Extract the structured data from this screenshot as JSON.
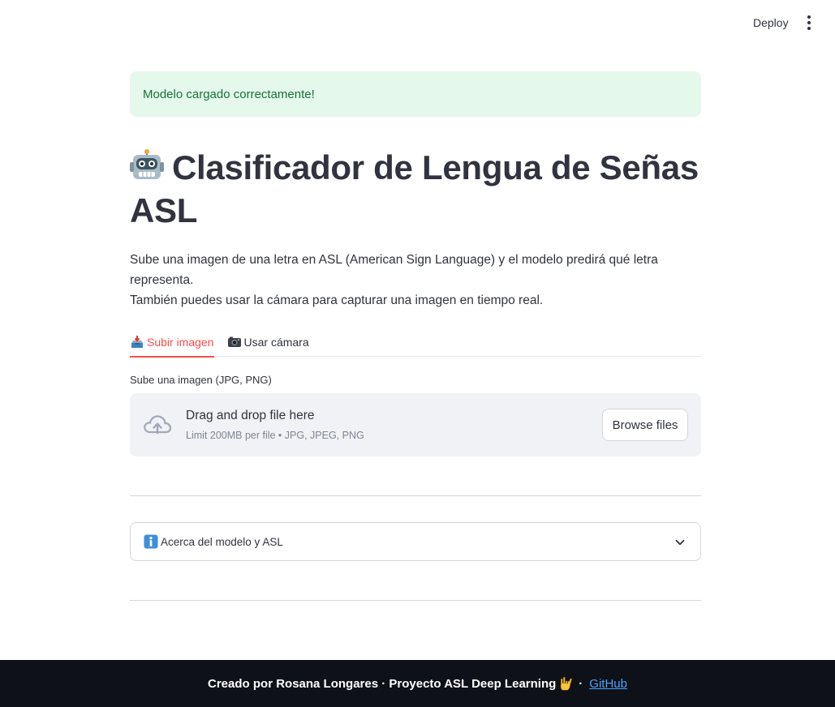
{
  "header": {
    "deploy_label": "Deploy",
    "menu_icon": "kebab-menu-icon"
  },
  "alert": {
    "message": "Modelo cargado correctamente!",
    "color": "#177233",
    "background": "#e5f8ec"
  },
  "title": {
    "icon": "robot-emoji",
    "text": "Clasificador de Lengua de Señas ASL"
  },
  "description": {
    "line1": "Sube una imagen de una letra en ASL (American Sign Language) y el modelo predirá qué letra representa.",
    "line2": "También puedes usar la cámara para capturar una imagen en tiempo real."
  },
  "tabs": [
    {
      "label": "Subir imagen",
      "icon": "inbox-tray-emoji",
      "active": true
    },
    {
      "label": "Usar cámara",
      "icon": "camera-emoji",
      "active": false
    }
  ],
  "uploader": {
    "label": "Sube una imagen (JPG, PNG)",
    "drop_title": "Drag and drop file here",
    "limit": "Limit 200MB per file • JPG, JPEG, PNG",
    "browse_label": "Browse files",
    "icon": "cloud-upload-icon"
  },
  "expander": {
    "icon": "information-emoji",
    "label": "Acerca del modelo y ASL",
    "expanded": false
  },
  "footer": {
    "text": "Creado por Rosana Longares · Proyecto ASL Deep Learning",
    "separator": "·",
    "link_label": "GitHub",
    "icon": "love-you-gesture-emoji"
  },
  "colors": {
    "accent": "#ff4b4b",
    "text": "#31333f",
    "footer_bg": "#0e1117",
    "link": "#4aa3ff"
  }
}
